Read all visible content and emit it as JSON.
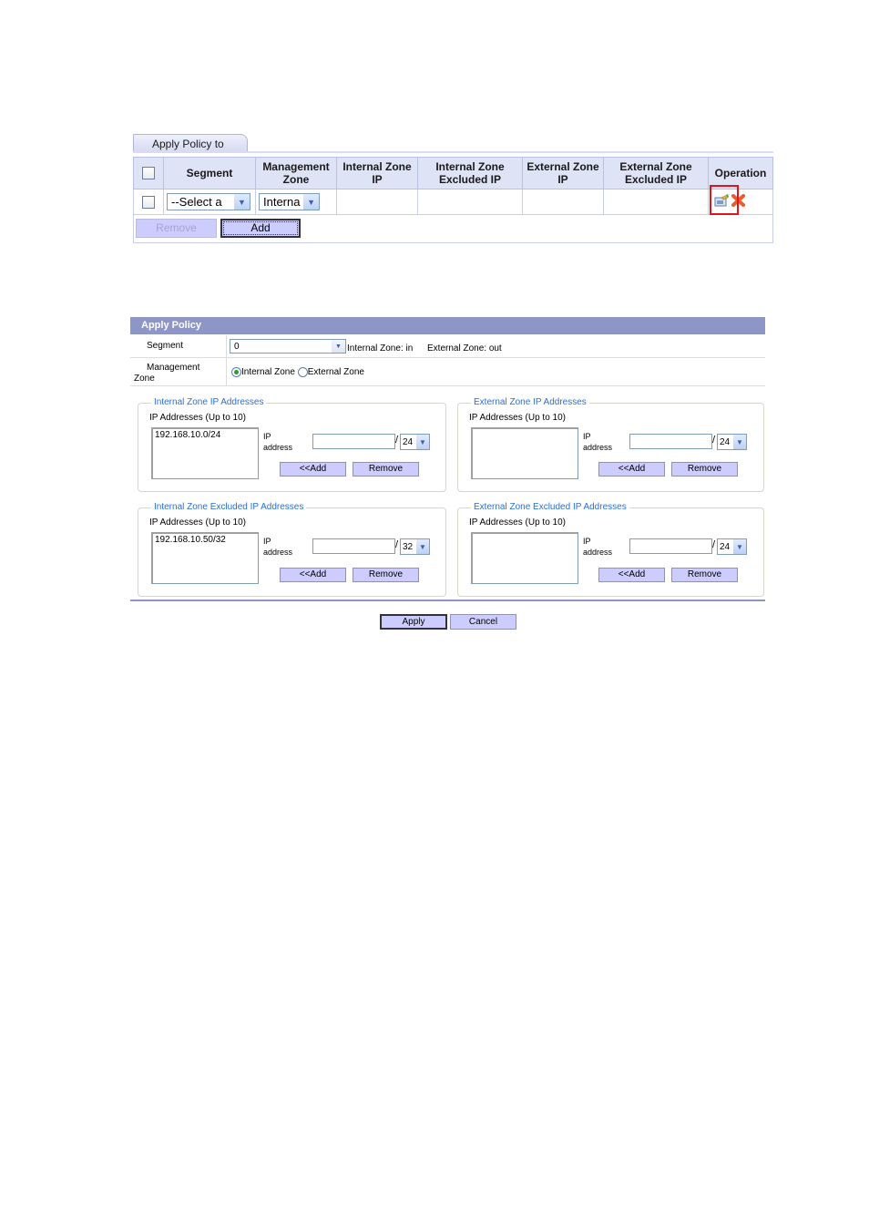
{
  "apply_policy_to": {
    "tab_label": "Apply Policy to",
    "columns": [
      "Segment",
      "Management Zone",
      "Internal Zone IP",
      "Internal Zone Excluded IP",
      "External Zone IP",
      "External Zone Excluded IP",
      "Operation"
    ],
    "rows": [
      {
        "segment": "--Select a",
        "management_zone": "Interna",
        "internal_zone_ip": "",
        "internal_zone_excluded_ip": "",
        "external_zone_ip": "",
        "external_zone_excluded_ip": "",
        "operations": [
          "edit-icon",
          "delete-icon"
        ]
      }
    ],
    "remove_label": "Remove",
    "add_label": "Add"
  },
  "apply_policy": {
    "title": "Apply Policy",
    "segment_label": "Segment",
    "segment_value": "0",
    "segment_hint_internal": "Internal Zone: in",
    "segment_hint_external": "External Zone: out",
    "management_zone_label": "Management Zone",
    "management_zone_options": [
      "Internal Zone",
      "External Zone"
    ],
    "management_zone_selected": "Internal Zone",
    "zones": [
      {
        "legend": "Internal Zone IP Addresses",
        "sub": "IP Addresses (Up to 10)",
        "entries": [
          "192.168.10.0/24"
        ],
        "ip_label": "IP address",
        "ip_value": "",
        "mask": "24",
        "add_label": "<<Add",
        "remove_label": "Remove"
      },
      {
        "legend": "External Zone IP Addresses",
        "sub": "IP Addresses (Up to 10)",
        "entries": [],
        "ip_label": "IP address",
        "ip_value": "",
        "mask": "24",
        "add_label": "<<Add",
        "remove_label": "Remove"
      },
      {
        "legend": "Internal Zone Excluded IP Addresses",
        "sub": "IP Addresses (Up to 10)",
        "entries": [
          "192.168.10.50/32"
        ],
        "ip_label": "IP address",
        "ip_value": "",
        "mask": "32",
        "add_label": "<<Add",
        "remove_label": "Remove"
      },
      {
        "legend": "External Zone Excluded IP Addresses",
        "sub": "IP Addresses (Up to 10)",
        "entries": [],
        "ip_label": "IP address",
        "ip_value": "",
        "mask": "24",
        "add_label": "<<Add",
        "remove_label": "Remove"
      }
    ],
    "apply_label": "Apply",
    "cancel_label": "Cancel"
  }
}
